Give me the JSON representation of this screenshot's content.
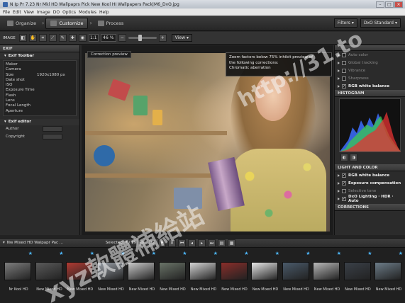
{
  "window": {
    "title": "N Ip Pr 7.23 Nr Mkl HD Wallpaprs Pick New Kool HI Wallpapers Pack|M6_DvO.jpg",
    "controls": [
      "–",
      "□",
      "×"
    ]
  },
  "menu": [
    "File",
    "Edit",
    "View",
    "Image",
    "DO",
    "Optics",
    "Modules",
    "Help"
  ],
  "tabs": [
    {
      "label": "Organize"
    },
    {
      "label": "Customize"
    },
    {
      "label": "Process"
    }
  ],
  "tabbar_right": {
    "filters_label": "Filters",
    "workspace_label": "DxO Standard"
  },
  "toolbar": {
    "image_label": "IMAGE",
    "zoom_percent": "1:1",
    "zoom_value": "46 %",
    "view_label": "View"
  },
  "left_panel": {
    "header": "EXIF",
    "section_title": "Exif Toolbar",
    "rows": [
      {
        "k": "Maker",
        "v": ""
      },
      {
        "k": "Camera",
        "v": ""
      },
      {
        "k": "Size",
        "v": "1920x1080 px"
      },
      {
        "k": "Date shot",
        "v": ""
      },
      {
        "k": "ISO",
        "v": ""
      },
      {
        "k": "Exposure Time",
        "v": ""
      },
      {
        "k": "Flash",
        "v": ""
      },
      {
        "k": "Lens",
        "v": ""
      },
      {
        "k": "Focal Length",
        "v": ""
      },
      {
        "k": "Aperture",
        "v": ""
      }
    ],
    "editor_title": "Exif editor",
    "editor_rows": [
      {
        "k": "Author"
      },
      {
        "k": "Copyright"
      }
    ]
  },
  "viewer": {
    "preview_tag": "Correction preview",
    "tooltip": [
      "Zoom factors below 75% inhibit preview of",
      "the following corrections:",
      "Chromatic aberration"
    ]
  },
  "right_panel": {
    "rows_top": [
      {
        "label": "Auto color",
        "on": false
      },
      {
        "label": "Global tracking",
        "on": false
      },
      {
        "label": "Vibrance",
        "on": false
      },
      {
        "label": "Sharpness",
        "on": false
      },
      {
        "label": "RGB white balance",
        "on": true
      }
    ],
    "histogram_header": "HISTOGRAM",
    "light_header": "LIGHT AND COLOR",
    "light_rows": [
      {
        "label": "RGB white balance",
        "on": true
      },
      {
        "label": "Exposure compensation",
        "on": true
      },
      {
        "label": "Selective tone",
        "on": false
      },
      {
        "label": "DxO Lighting · HDR · Auto",
        "on": true
      }
    ],
    "corrections_header": "CORRECTIONS"
  },
  "filmstrip": {
    "folder": "Nw Mixed HD Walpapr Pac ...",
    "selection": "Selected: 2 / 19",
    "items": [
      {
        "label": "Nr Kool HD",
        "color": "#7d7d7d"
      },
      {
        "label": "New Mixed HD",
        "color": "#5a5a5a"
      },
      {
        "label": "New Mixed HD",
        "color": "#b03a32"
      },
      {
        "label": "New Mixed HD",
        "color": "#9aa0a8"
      },
      {
        "label": "New Mixed HD",
        "color": "#c9c9c9"
      },
      {
        "label": "New Mixed HD",
        "color": "#6a7468"
      },
      {
        "label": "New Mixed HD",
        "color": "#d4d4d4"
      },
      {
        "label": "New Mixed HD",
        "color": "#8a2e2a"
      },
      {
        "label": "New Mixed HD",
        "color": "#e8e8e8"
      },
      {
        "label": "New Mixed HD",
        "color": "#4a5a6a"
      },
      {
        "label": "New Mixed HD",
        "color": "#b8b8b8"
      },
      {
        "label": "New Mixed HD",
        "color": "#3a4048"
      },
      {
        "label": "New Mixed HD",
        "color": "#6c7c88"
      }
    ]
  },
  "watermark": {
    "url": "http://31.to",
    "cn": "xyz軟體補給站"
  }
}
